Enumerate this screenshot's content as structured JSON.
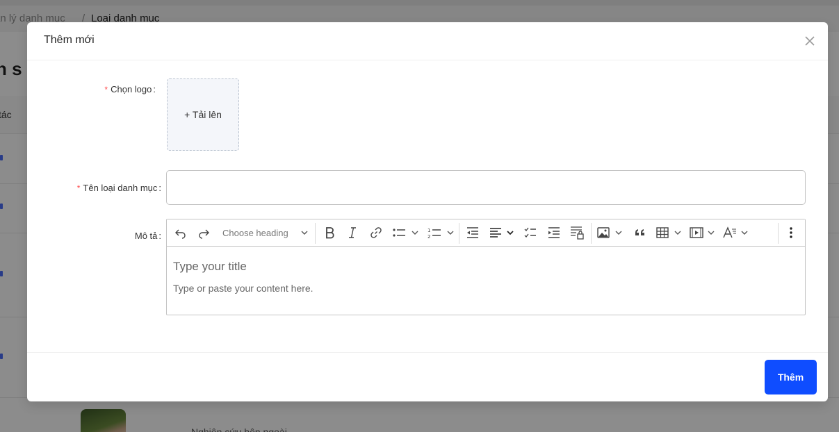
{
  "background": {
    "breadcrumb": {
      "parent": "ản lý danh mục",
      "separator": "/",
      "current": "Loại danh mục"
    },
    "page_heading": "h s",
    "table_header_actions": "tác",
    "row_text": "Nghiên cứu bên ngoài"
  },
  "modal": {
    "title": "Thêm mới",
    "close_icon": "close-icon",
    "fields": {
      "logo": {
        "label": "Chọn logo",
        "required": "*",
        "upload_label": "+ Tải lên"
      },
      "name": {
        "label": "Tên loại danh mục",
        "required": "*",
        "value": ""
      },
      "description": {
        "label": "Mô tả"
      }
    },
    "editor": {
      "heading_select": "Choose heading",
      "title_placeholder": "Type your title",
      "body_placeholder": "Type or paste your content here.",
      "toolbar_icons": [
        "undo-icon",
        "redo-icon",
        "bold-icon",
        "italic-icon",
        "link-icon",
        "bulleted-list-icon",
        "numbered-list-icon",
        "outdent-icon",
        "align-left-icon",
        "todo-list-icon",
        "indent-icon",
        "restricted-editing-icon",
        "image-icon",
        "blockquote-icon",
        "table-icon",
        "media-embed-icon",
        "font-style-icon",
        "more-icon"
      ]
    },
    "submit_label": "Thêm"
  },
  "colors": {
    "primary": "#0f4dff",
    "required": "#ff4d4f",
    "mask": "rgba(0,0,0,0.45)"
  }
}
